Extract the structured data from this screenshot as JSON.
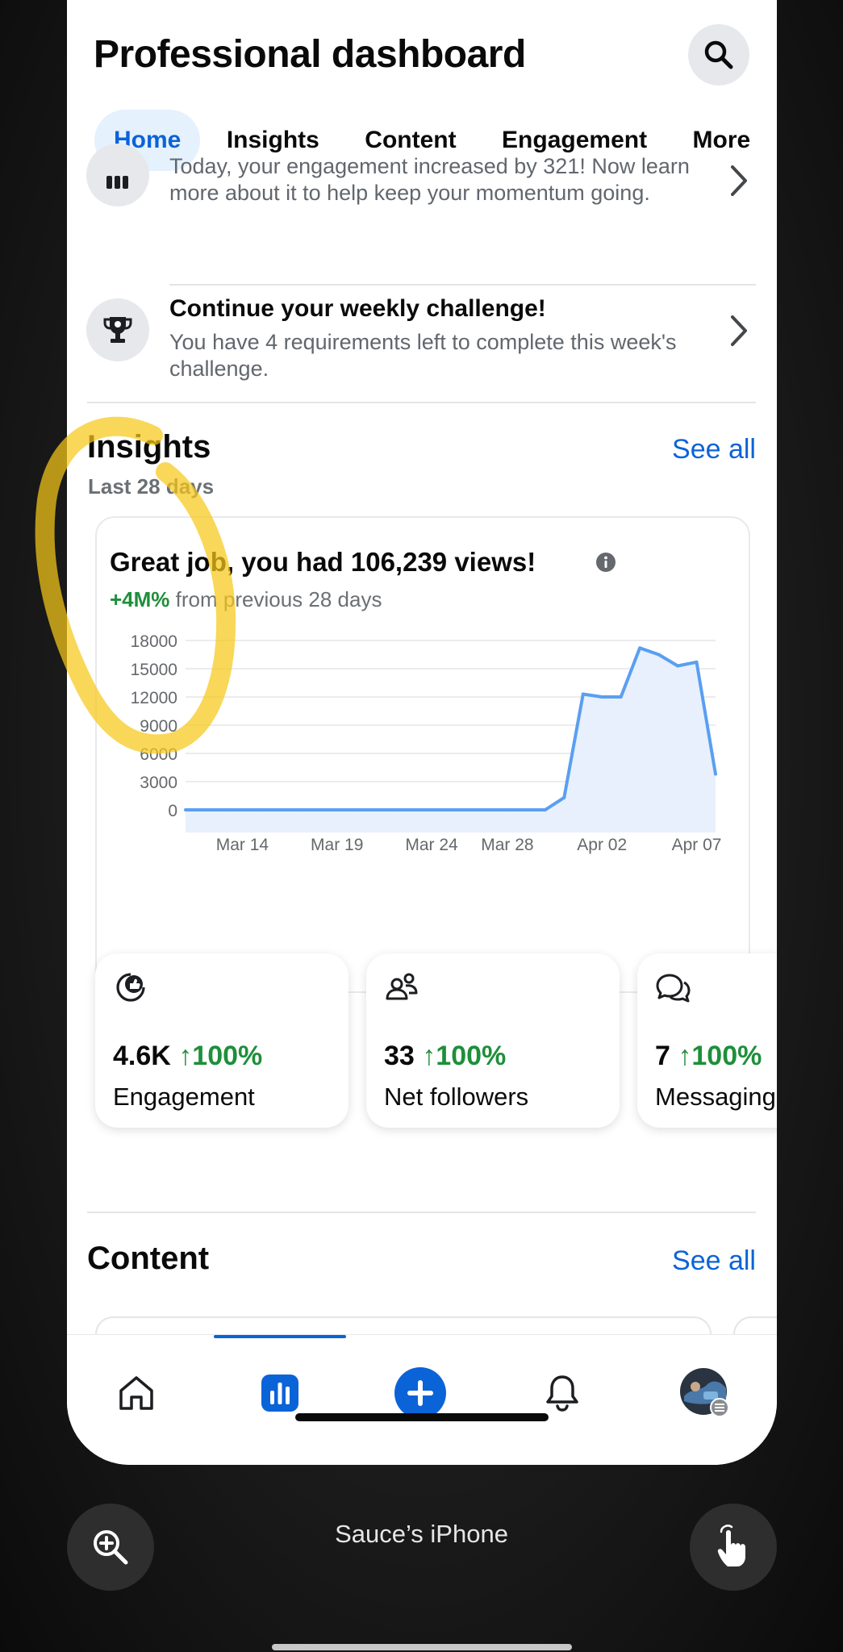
{
  "header": {
    "title": "Professional dashboard"
  },
  "tabs": [
    {
      "label": "Home",
      "active": true
    },
    {
      "label": "Insights",
      "active": false
    },
    {
      "label": "Content",
      "active": false
    },
    {
      "label": "Engagement",
      "active": false
    },
    {
      "label": "More",
      "active": false
    }
  ],
  "notifications": [
    {
      "title": "",
      "text": "Today, your engagement increased by 321! Now learn more about it to help keep your momentum going.",
      "icon": "bar-chart-icon"
    },
    {
      "title": "Continue your weekly challenge!",
      "text": "You have 4 requirements left to complete this week's challenge.",
      "icon": "trophy-icon"
    }
  ],
  "insights": {
    "title": "Insights",
    "see_all": "See all",
    "range": "Last 28 days",
    "headline": "Great job, you had 106,239 views!",
    "change": "+4M%",
    "change_suffix": "from previous 28 days"
  },
  "chart_data": {
    "type": "area",
    "title": "",
    "xlabel": "",
    "ylabel": "",
    "ylim": [
      0,
      18000
    ],
    "yticks": [
      0,
      3000,
      6000,
      9000,
      12000,
      15000,
      18000
    ],
    "xtick_labels": [
      "Mar 14",
      "Mar 19",
      "Mar 24",
      "Mar 28",
      "Apr 02",
      "Apr 07"
    ],
    "x": [
      "Mar 11",
      "Mar 12",
      "Mar 13",
      "Mar 14",
      "Mar 15",
      "Mar 16",
      "Mar 17",
      "Mar 18",
      "Mar 19",
      "Mar 20",
      "Mar 21",
      "Mar 22",
      "Mar 23",
      "Mar 24",
      "Mar 25",
      "Mar 26",
      "Mar 27",
      "Mar 28",
      "Mar 29",
      "Mar 30",
      "Mar 31",
      "Apr 01",
      "Apr 02",
      "Apr 03",
      "Apr 04",
      "Apr 05",
      "Apr 06",
      "Apr 07",
      "Apr 08"
    ],
    "series": [
      {
        "values": [
          0,
          0,
          0,
          0,
          0,
          0,
          0,
          0,
          0,
          0,
          0,
          0,
          0,
          0,
          0,
          0,
          0,
          0,
          0,
          0,
          1300,
          12300,
          12000,
          12000,
          17200,
          16500,
          15300,
          15700,
          3800
        ]
      }
    ],
    "line_color": "#5a9ff0",
    "fill_color": "#e7f0fc",
    "grid": true
  },
  "stats": [
    {
      "value": "4.6K",
      "change": "↑100%",
      "label": "Engagement",
      "icon": "engagement-icon"
    },
    {
      "value": "33",
      "change": "↑100%",
      "label": "Net followers",
      "icon": "followers-icon"
    },
    {
      "value": "7",
      "change": "↑100%",
      "label": "Messaging",
      "icon": "messaging-icon"
    }
  ],
  "content": {
    "title": "Content",
    "see_all": "See all"
  },
  "bottom_nav": [
    {
      "name": "home-icon",
      "active": false
    },
    {
      "name": "insights-icon",
      "active": true
    },
    {
      "name": "create-icon",
      "active": false
    },
    {
      "name": "notifications-icon",
      "active": false
    },
    {
      "name": "profile-avatar",
      "active": false
    }
  ],
  "device": {
    "name": "Sauce’s iPhone"
  },
  "colors": {
    "accent": "#0b63d8",
    "positive": "#1e8f3a",
    "highlight": "#f6c819"
  }
}
